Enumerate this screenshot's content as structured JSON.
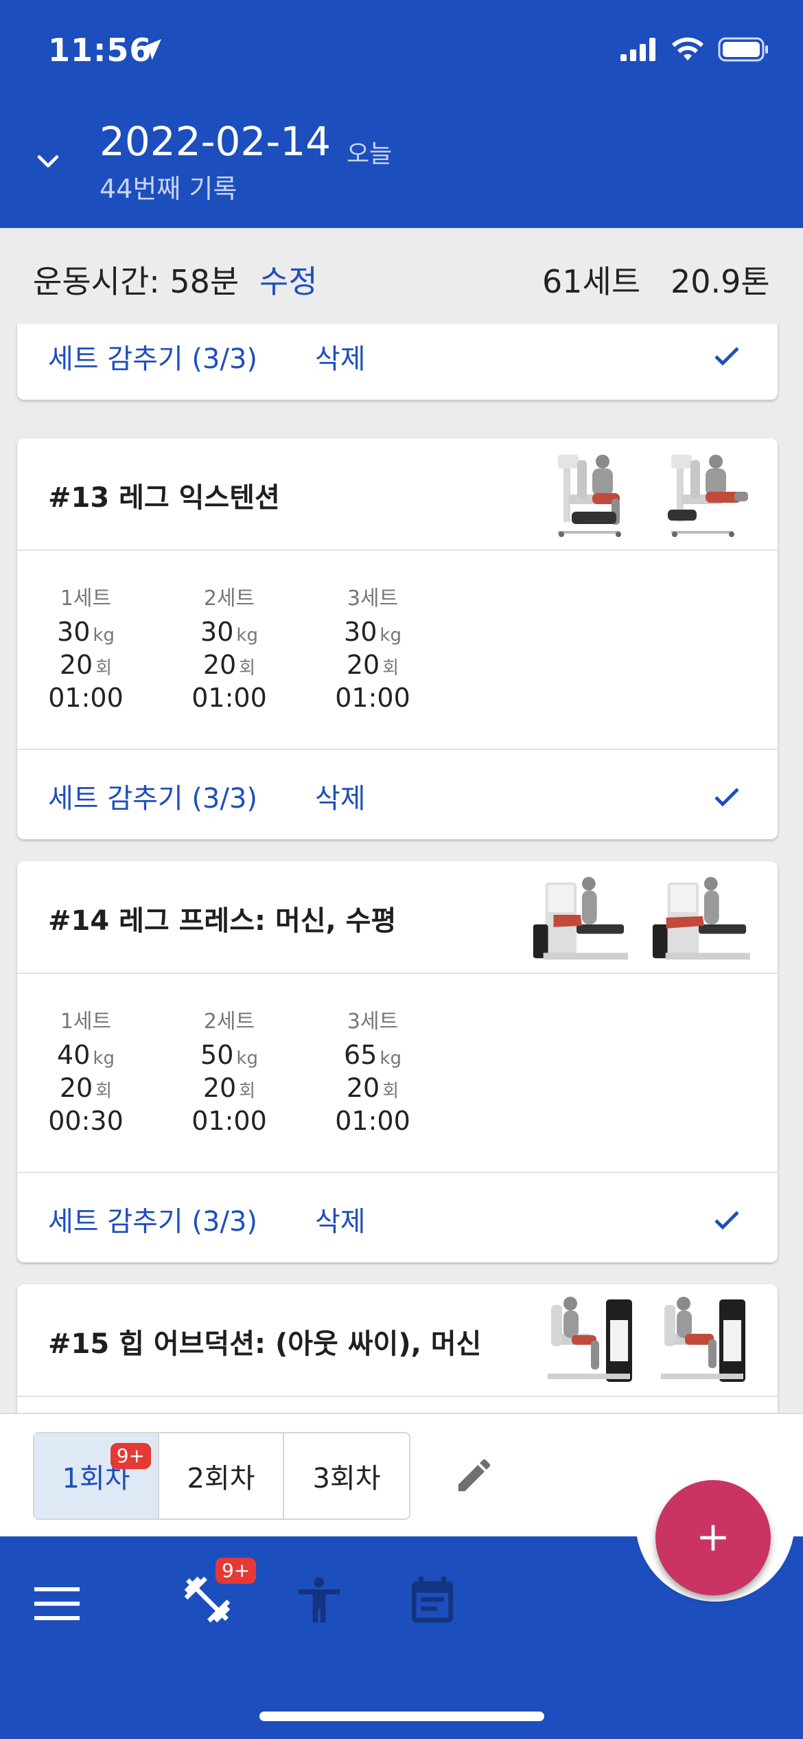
{
  "status": {
    "time": "11:56"
  },
  "header": {
    "date": "2022-02-14",
    "today_label": "오늘",
    "record_label": "44번째 기록"
  },
  "summary": {
    "workout_time": "운동시간: 58분",
    "edit_label": "수정",
    "sets": "61세트",
    "tonnage": "20.9톤"
  },
  "cards": [
    {
      "footer": {
        "hide_label": "세트 감추기 (3/3)",
        "delete_label": "삭제"
      }
    },
    {
      "title": "#13 레그 익스텐션",
      "sets": [
        {
          "label": "1세트",
          "weight": "30",
          "weight_unit": "kg",
          "reps": "20",
          "reps_unit": "회",
          "time": "01:00"
        },
        {
          "label": "2세트",
          "weight": "30",
          "weight_unit": "kg",
          "reps": "20",
          "reps_unit": "회",
          "time": "01:00"
        },
        {
          "label": "3세트",
          "weight": "30",
          "weight_unit": "kg",
          "reps": "20",
          "reps_unit": "회",
          "time": "01:00"
        }
      ],
      "footer": {
        "hide_label": "세트 감추기 (3/3)",
        "delete_label": "삭제"
      }
    },
    {
      "title": "#14 레그 프레스: 머신, 수평",
      "sets": [
        {
          "label": "1세트",
          "weight": "40",
          "weight_unit": "kg",
          "reps": "20",
          "reps_unit": "회",
          "time": "00:30"
        },
        {
          "label": "2세트",
          "weight": "50",
          "weight_unit": "kg",
          "reps": "20",
          "reps_unit": "회",
          "time": "01:00"
        },
        {
          "label": "3세트",
          "weight": "65",
          "weight_unit": "kg",
          "reps": "20",
          "reps_unit": "회",
          "time": "01:00"
        }
      ],
      "footer": {
        "hide_label": "세트 감추기 (3/3)",
        "delete_label": "삭제"
      }
    },
    {
      "title": "#15 힙 어브덕션: (아웃 싸이), 머신"
    }
  ],
  "session_tabs": [
    {
      "label": "1회차",
      "badge": "9+",
      "active": true
    },
    {
      "label": "2회차"
    },
    {
      "label": "3회차"
    }
  ],
  "bottom_nav": {
    "workout_badge": "9+"
  },
  "colors": {
    "primary": "#1d4ebd",
    "fab": "#c93463",
    "badge": "#e53935",
    "active_tab_bg": "#dfe8f5"
  },
  "icons": [
    "location-arrow-icon",
    "signal-icon",
    "wifi-icon",
    "battery-icon",
    "chevron-down-icon",
    "check-icon",
    "pencil-icon",
    "plus-icon",
    "menu-icon",
    "dumbbell-icon",
    "person-icon",
    "calendar-icon"
  ]
}
